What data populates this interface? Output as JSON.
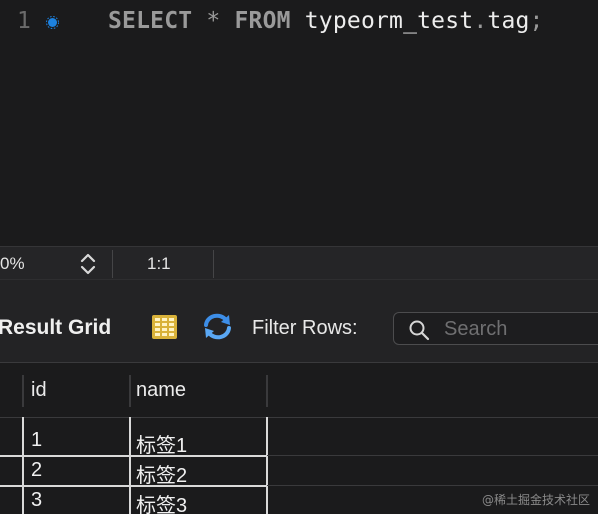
{
  "editor": {
    "line_number": "1",
    "tokens": {
      "select": "SELECT",
      "star": "*",
      "from": "FROM",
      "table": "typeorm_test",
      "dot": ".",
      "name": "tag",
      "semicolon": ";"
    }
  },
  "status_bar": {
    "zoom": "0%",
    "cursor_position": "1:1"
  },
  "toolbar": {
    "result_grid_label": "Result Grid",
    "filter_label": "Filter Rows:",
    "search_placeholder": "Search"
  },
  "grid": {
    "columns": [
      "id",
      "name"
    ],
    "rows": [
      [
        "1",
        "标签1"
      ],
      [
        "2",
        "标签2"
      ],
      [
        "3",
        "标签3"
      ]
    ]
  },
  "watermark": "@稀土掘金技术社区",
  "colors": {
    "background": "#1b1b1c",
    "exec_dot": "#1d82e0",
    "keyword": "#9a9a9a"
  },
  "icons": [
    "execution-dot-icon",
    "stepper-icon",
    "grid-view-icon",
    "refresh-icon",
    "search-icon"
  ]
}
